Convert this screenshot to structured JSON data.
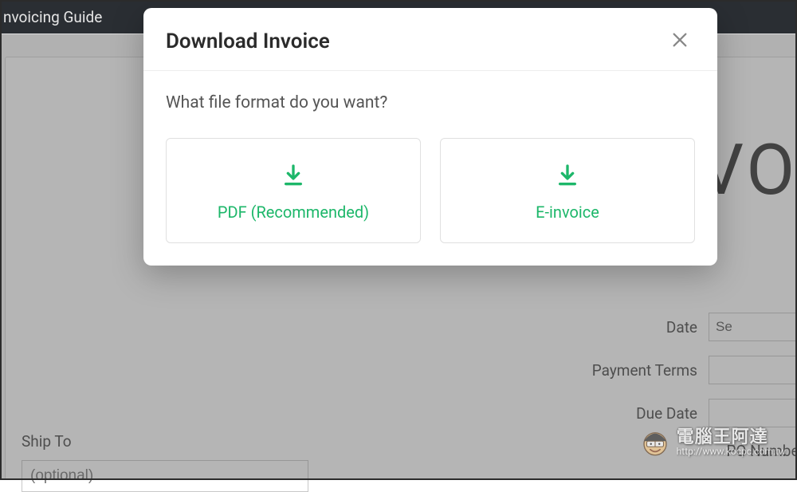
{
  "topbar": {
    "guide_link": "nvoicing Guide"
  },
  "invoice": {
    "big_title_fragment": "VOI",
    "ship_to_label": "Ship To",
    "ship_to_placeholder": "(optional)",
    "fields": {
      "date_label": "Date",
      "date_value_fragment": "Se",
      "payment_terms_label": "Payment Terms",
      "due_date_label": "Due Date",
      "po_number_label": "PO Number"
    }
  },
  "modal": {
    "title": "Download Invoice",
    "question": "What file format do you want?",
    "options": {
      "pdf": "PDF (Recommended)",
      "einvoice": "E-invoice"
    }
  },
  "watermark": {
    "text": "電腦王阿達",
    "url": "http://www.kocpc.com.tw"
  }
}
